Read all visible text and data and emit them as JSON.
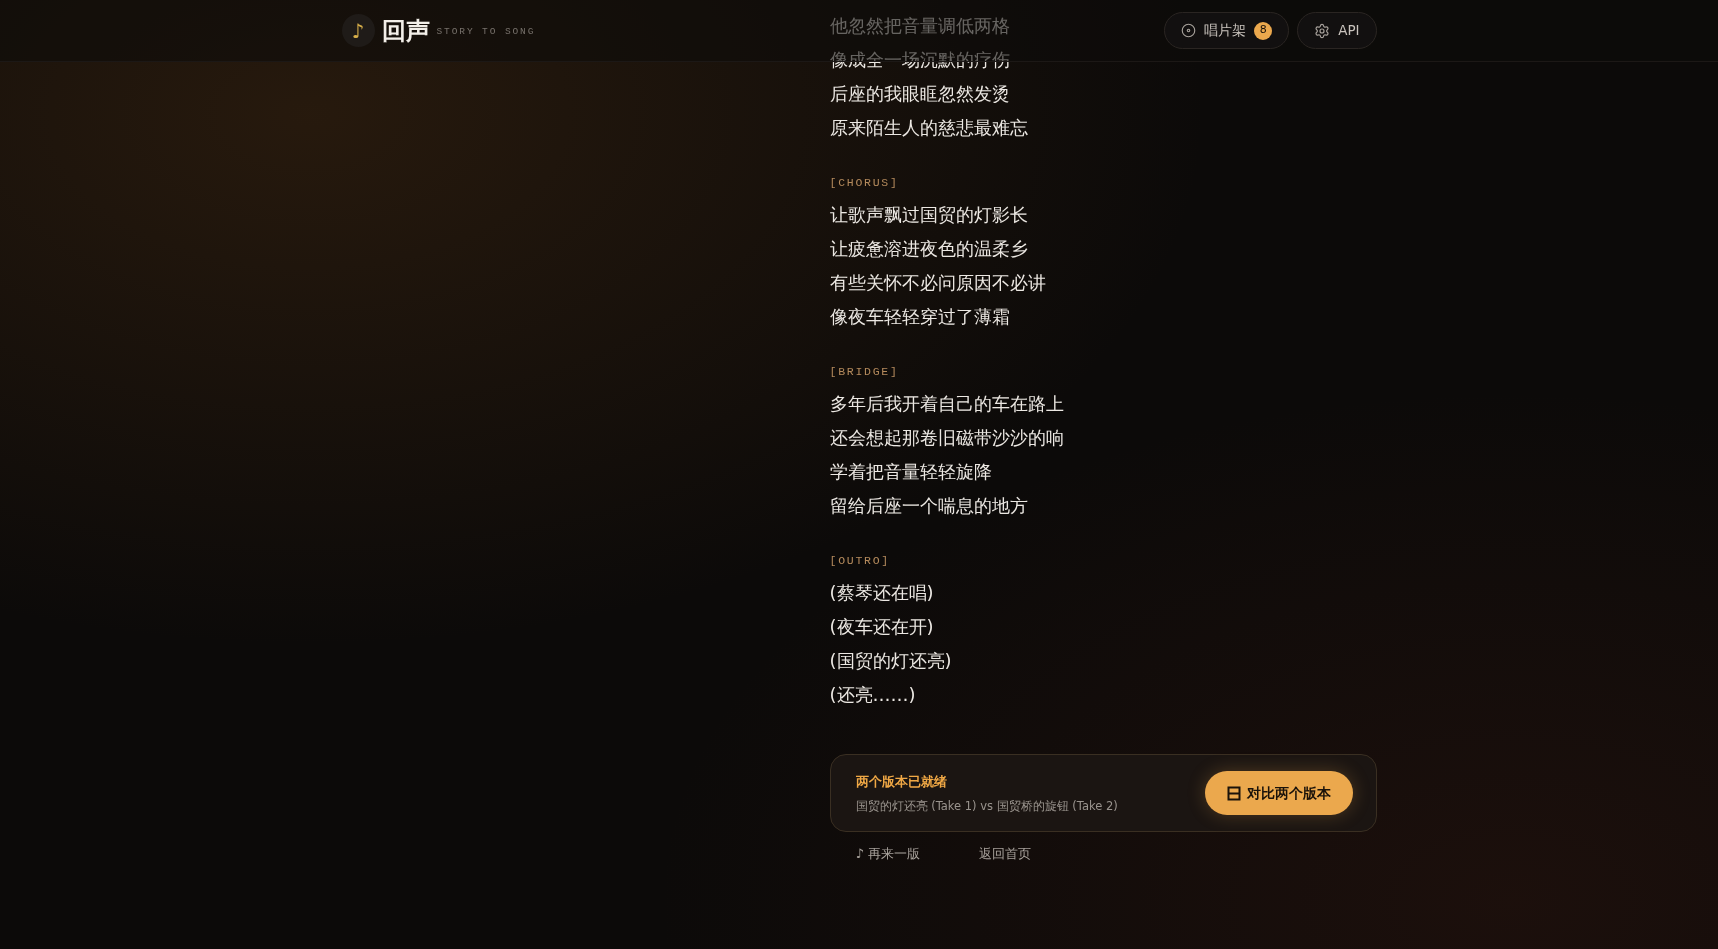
{
  "header": {
    "logo": {
      "symbol": "♪",
      "title": "回声",
      "tagline": "STORY TO SONG"
    },
    "buttons": [
      {
        "kind": "shelf",
        "label": "唱片架",
        "badge": "8"
      },
      {
        "kind": "settings",
        "label": "API"
      }
    ]
  },
  "lyrics": {
    "sections": [
      {
        "lines": [
          "他忽然把音量调低两格",
          "像成全一场沉默的疗伤",
          "后座的我眼眶忽然发烫",
          "原来陌生人的慈悲最难忘"
        ]
      },
      {
        "tag": "[CHORUS]",
        "lines": [
          "让歌声飘过国贸的灯影长",
          "让疲惫溶进夜色的温柔乡",
          "有些关怀不必问原因不必讲",
          "像夜车轻轻穿过了薄霜"
        ]
      },
      {
        "tag": "[BRIDGE]",
        "lines": [
          "多年后我开着自己的车在路上",
          "还会想起那卷旧磁带沙沙的响",
          "学着把音量轻轻旋降",
          "留给后座一个喘息的地方"
        ]
      },
      {
        "tag": "[OUTRO]",
        "lines": [
          "(蔡琴还在唱)",
          "(夜车还在开)",
          "(国贸的灯还亮)",
          "(还亮……)"
        ]
      }
    ]
  },
  "ready_card": {
    "title": "两个版本已就绪",
    "subtitle": "国贸的灯还亮 (Take 1) vs 国贸桥的旋钮 (Take 2)",
    "button": "对比两个版本"
  },
  "links": [
    "♪ 再来一版",
    "返回首页"
  ]
}
